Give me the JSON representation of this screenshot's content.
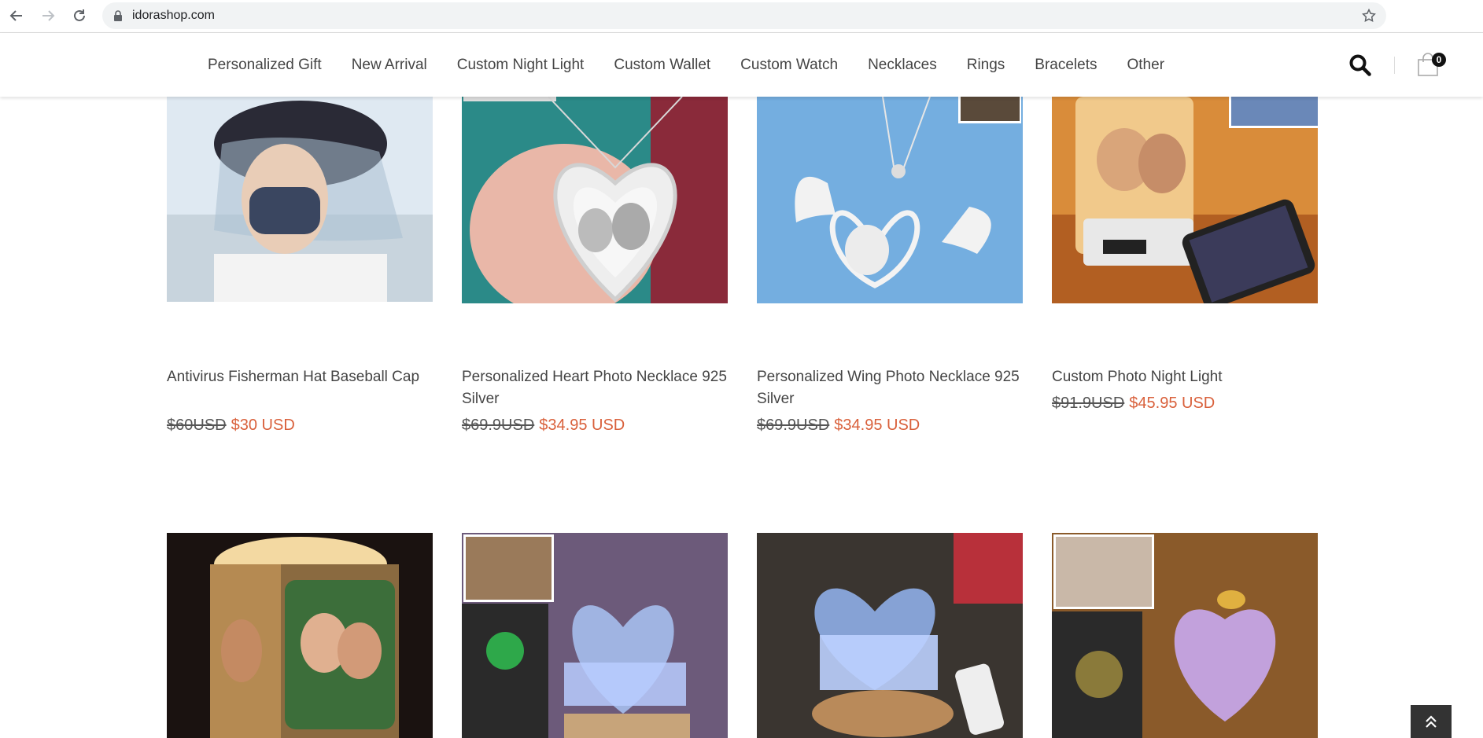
{
  "browser": {
    "url": "idorashop.com"
  },
  "nav": {
    "items": [
      "Personalized Gift",
      "New Arrival",
      "Custom Night Light",
      "Custom Wallet",
      "Custom Watch",
      "Necklaces",
      "Rings",
      "Bracelets",
      "Other"
    ]
  },
  "cart": {
    "count": "0"
  },
  "colors": {
    "sale_price": "#d9603b",
    "old_price": "#555555",
    "nav_text": "#444444"
  },
  "products": [
    {
      "title": "Antivirus Fisherman Hat Baseball Cap",
      "old_price": "$60USD",
      "price": "$30 USD"
    },
    {
      "title": "Personalized Heart Photo Necklace 925 Silver",
      "old_price": "$69.9USD",
      "price": "$34.95 USD"
    },
    {
      "title": "Personalized Wing Photo Necklace 925 Silver",
      "old_price": "$69.9USD",
      "price": "$34.95 USD"
    },
    {
      "title": "Custom Photo Night Light",
      "old_price": "$91.9USD",
      "price": "$45.95 USD"
    }
  ],
  "icons": {
    "back": "arrow-left-icon",
    "forward": "arrow-right-icon",
    "reload": "reload-icon",
    "lock": "lock-icon",
    "bookmark": "star-icon",
    "search": "search-icon",
    "cart": "shopping-bag-icon",
    "back_to_top": "double-chevron-up-icon"
  }
}
